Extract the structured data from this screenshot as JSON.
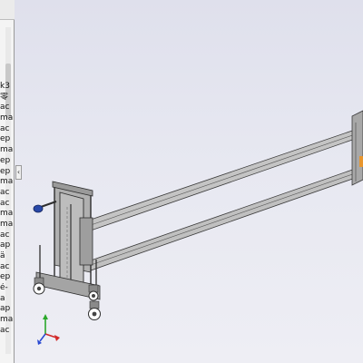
{
  "feature_tree": {
    "items": [
      {
        "label": "k3",
        "icon": "part-icon"
      },
      {
        "label": "零",
        "icon": "part-icon"
      },
      {
        "label": "ac",
        "icon": "part-icon"
      },
      {
        "label": "ma",
        "icon": "part-icon"
      },
      {
        "label": "ac",
        "icon": "part-icon"
      },
      {
        "label": "ep",
        "icon": "part-icon"
      },
      {
        "label": "ma",
        "icon": "part-icon"
      },
      {
        "label": "ep",
        "icon": "part-icon"
      },
      {
        "label": "ep",
        "icon": "part-icon"
      },
      {
        "label": "ma",
        "icon": "part-icon"
      },
      {
        "label": "ac",
        "icon": "part-icon"
      },
      {
        "label": "ac",
        "icon": "part-icon"
      },
      {
        "label": "ma",
        "icon": "part-icon"
      },
      {
        "label": "ma",
        "icon": "part-icon"
      },
      {
        "label": "ac",
        "icon": "part-icon"
      },
      {
        "label": "ap",
        "icon": "part-icon"
      },
      {
        "label": "ä",
        "icon": "part-icon"
      },
      {
        "label": "ac",
        "icon": "part-icon"
      },
      {
        "label": "ep",
        "icon": "part-icon"
      },
      {
        "label": "é-",
        "icon": "part-icon"
      },
      {
        "label": "a",
        "icon": "part-icon"
      },
      {
        "label": "ap",
        "icon": "part-icon"
      },
      {
        "label": "ma",
        "icon": "part-icon"
      },
      {
        "label": "ac",
        "icon": "part-icon"
      }
    ],
    "collapse_glyph": "‹"
  },
  "viewport": {
    "background_top": "#dfe0ec",
    "background_bottom": "#eeeef4",
    "model_stroke": "#3a3a3a",
    "model_fill": "#b8b8b8",
    "model_fill_dark": "#8a8a8a",
    "accent_orange": "#e8962e",
    "handle_blue": "#2848a8"
  },
  "triad": {
    "axis_x_color": "#d22a2a",
    "axis_y_color": "#2aa82a",
    "axis_z_color": "#2a4ad2"
  }
}
